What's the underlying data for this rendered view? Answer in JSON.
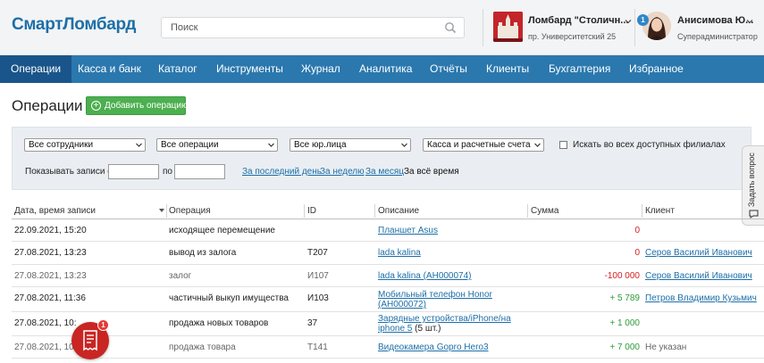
{
  "header": {
    "logo": "СмартЛомбард",
    "search_placeholder": "Поиск",
    "branch": {
      "name": "Ломбард \"Столичн...",
      "address": "пр. Университетский 25"
    },
    "user": {
      "name": "Анисимова Ю...",
      "role": "Суперадминистратор",
      "notifications": "1"
    }
  },
  "nav": [
    "Операции",
    "Касса и банк",
    "Каталог",
    "Инструменты",
    "Журнал",
    "Аналитика",
    "Отчёты",
    "Клиенты",
    "Бухгалтерия",
    "Избранное"
  ],
  "page": {
    "title": "Операции",
    "add_button": "Добавить операцию"
  },
  "filters": {
    "employees": "Все сотрудники",
    "operations": "Все операции",
    "legal_entities": "Все юр.лица",
    "cash": "Касса и расчетные счета",
    "search_all_branches": "Искать во всех доступных филиалах",
    "show_from": "Показывать записи с",
    "to": "по",
    "last_day": "За последний день",
    "week": "За неделю",
    "month": "За месяц",
    "all_time": "За всё время"
  },
  "side_tab": "Задать вопрос",
  "table": {
    "columns": [
      "Дата, время записи",
      "Операция",
      "ID",
      "Описание",
      "Сумма",
      "Клиент"
    ],
    "rows": [
      {
        "date": "22.09.2021, 15:20",
        "operation": "исходящее перемещение",
        "id": "",
        "desc": "Планшет Asus",
        "desc2": "",
        "desc2_suffix": "",
        "sum": "0",
        "sum_color": "red",
        "client": "",
        "muted": false
      },
      {
        "date": "27.08.2021, 13:23",
        "operation": "вывод из залога",
        "id": "Т207",
        "desc": "lada kalina",
        "desc2": "",
        "desc2_suffix": "",
        "sum": "0",
        "sum_color": "red",
        "client": "Серов Василий Иванович",
        "muted": false
      },
      {
        "date": "27.08.2021, 13:23",
        "operation": "залог",
        "id": "И107",
        "desc": "lada kalina (АН000074)",
        "desc2": "",
        "desc2_suffix": "",
        "sum": "-100 000",
        "sum_color": "red",
        "client": "Серов Василий Иванович",
        "muted": true
      },
      {
        "date": "27.08.2021, 11:36",
        "operation": "частичный выкуп имущества",
        "id": "И103",
        "desc": "Мобильный телефон Honor",
        "desc2": "(АН000072)",
        "desc2_suffix": "",
        "sum": "+ 5 789",
        "sum_color": "green",
        "client": "Петров Владимир Кузьмич",
        "muted": false
      },
      {
        "date": "27.08.2021, 10:",
        "operation": "продажа новых товаров",
        "id": "37",
        "desc": "Зарядные устройства/iPhone/на",
        "desc2": "iphone 5",
        "desc2_suffix": " (5 шт.)",
        "sum": "+ 1 000",
        "sum_color": "green",
        "client": "",
        "muted": false
      },
      {
        "date": "27.08.2021, 10:",
        "operation": "продажа товара",
        "id": "Т141",
        "desc": "Видеокамера Gopro Hero3",
        "desc2": "",
        "desc2_suffix": "",
        "sum": "+ 7 000",
        "sum_color": "green",
        "client": "Не указан",
        "muted": true
      }
    ]
  },
  "fab_badge": "1",
  "colors": {
    "brand": "#1d6fa8",
    "nav": "#2b78ae",
    "nav_active": "#19558a",
    "add_button": "#4caf50",
    "negative": "#d52020",
    "positive": "#2f9a3a"
  },
  "icons": [
    "search-icon",
    "chevron-down-icon",
    "plus-icon",
    "question-icon",
    "receipt-icon",
    "sort-arrow-icon"
  ]
}
